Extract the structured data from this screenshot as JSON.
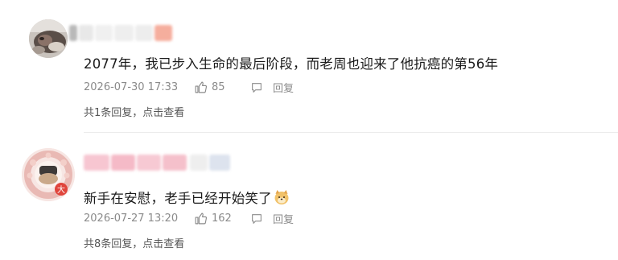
{
  "comments": [
    {
      "text": "2077年，我已步入生命的最后阶段，而老周也迎来了他抗癌的第56年",
      "timestamp": "2026-07-30 17:33",
      "likes": "85",
      "reply_label": "回复",
      "replies_summary": "共1条回复，点击查看",
      "avatar_icon": "dog-photo-avatar",
      "username_blurred": true
    },
    {
      "text": "新手在安慰，老手已经开始笑了",
      "emoji_icon": "doge-emoji-icon",
      "timestamp": "2026-07-27 13:20",
      "likes": "162",
      "reply_label": "回复",
      "replies_summary": "共8条回复，点击查看",
      "avatar_icon": "cartoon-wreath-avatar",
      "avatar_badge": "大",
      "username_blurred": true
    }
  ],
  "colors": {
    "meta_gray": "#8a8a8a",
    "divider": "#ececec",
    "blur_pink": "#f4b7c4",
    "blur_orange": "#f29a86"
  }
}
